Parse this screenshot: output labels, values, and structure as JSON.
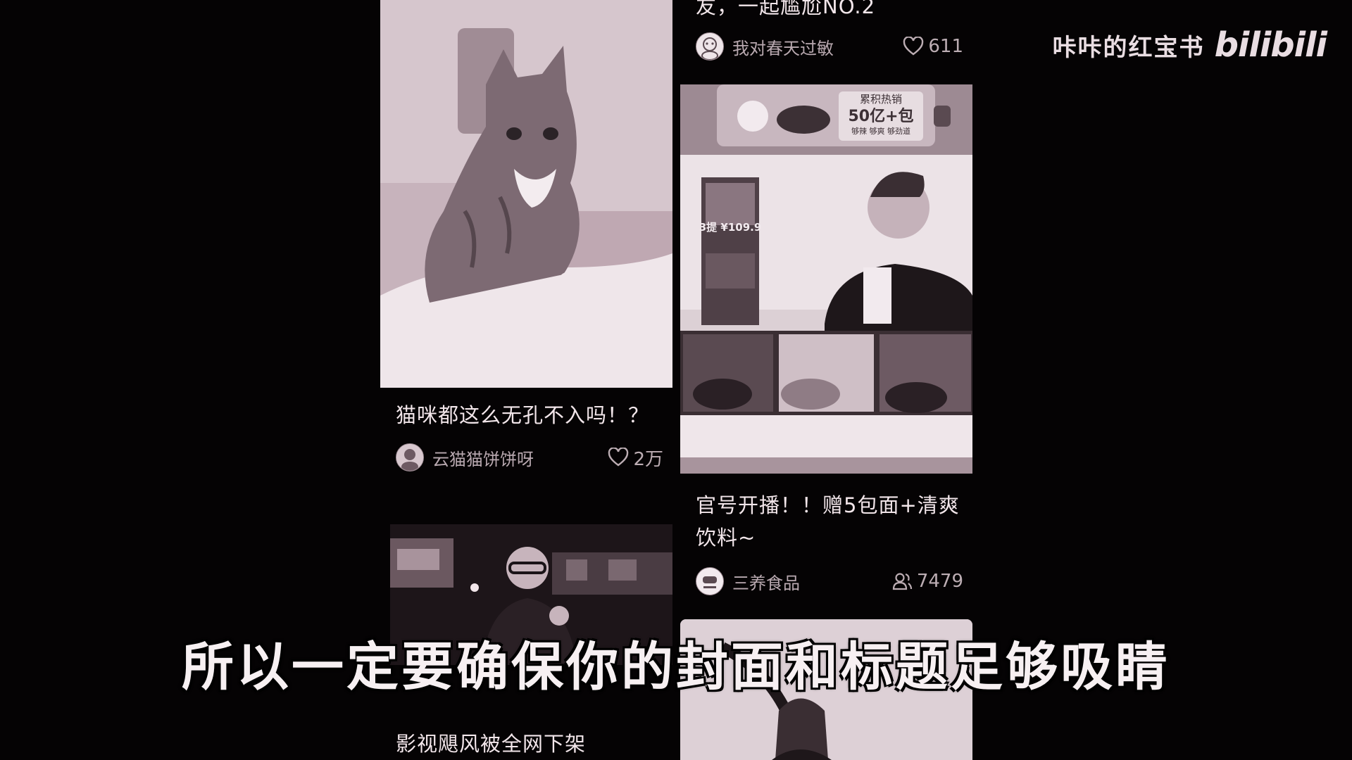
{
  "watermark": {
    "channel_name": "咔咔的红宝书",
    "logo_text": "bilibili"
  },
  "subtitle": "所以一定要确保你的封面和标题足够吸睛",
  "left_column": {
    "card1": {
      "title": "猫咪都这么无孔不入吗！？",
      "author": "云猫猫饼饼呀",
      "like_count": "2万",
      "like_icon": "heart-icon"
    },
    "card2": {
      "title": "影视飓风被全网下架"
    }
  },
  "right_column": {
    "card0": {
      "title_fragment": "友，一起尴尬NO.2",
      "author": "我对春天过敏",
      "like_count": "611",
      "like_icon": "heart-icon"
    },
    "card1": {
      "title": "官号开播！！赠5包面+清爽饮料~",
      "author": "三养食品",
      "viewer_count": "7479",
      "viewer_icon": "people-icon",
      "cover_texts": {
        "sales_line1": "累积热销",
        "sales_line2": "50亿+包",
        "sales_line3": "够辣 够爽 够劲道",
        "price": "3提 ¥109.9"
      }
    }
  },
  "colors": {
    "background": "#050304",
    "cover_tint": "#c9b4bd",
    "text_primary": "#f2e6ea",
    "text_secondary": "#b9a9b0"
  }
}
